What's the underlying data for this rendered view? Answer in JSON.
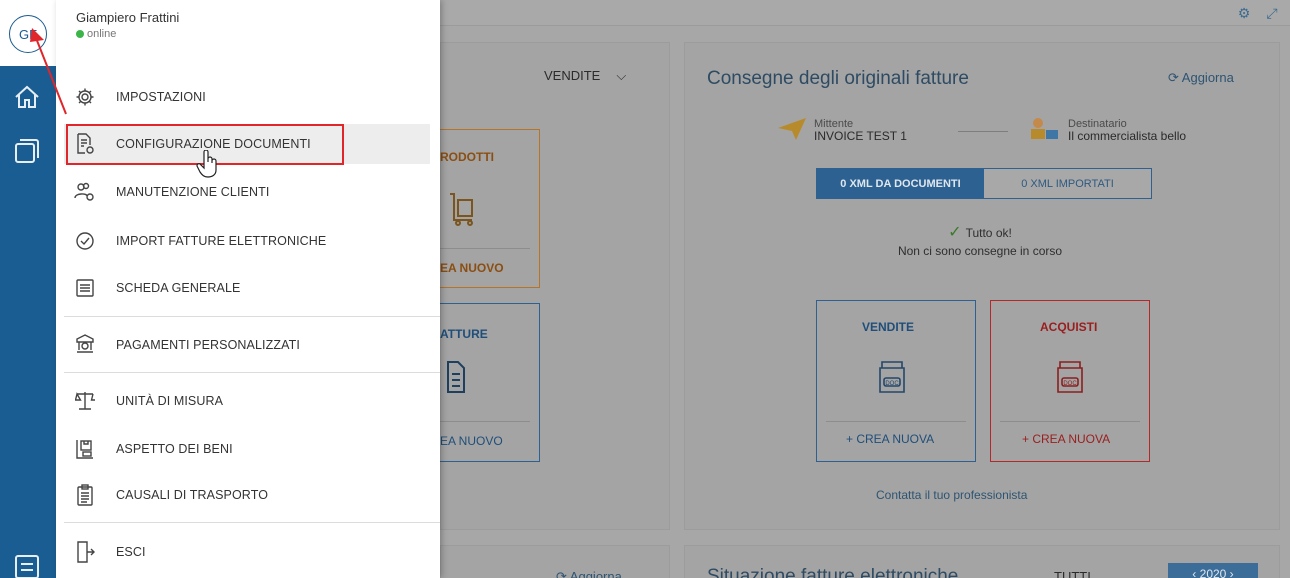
{
  "user": {
    "initials": "GF",
    "name": "Giampiero Frattini",
    "status": "online"
  },
  "menu": {
    "items": [
      {
        "label": "IMPOSTAZIONI",
        "icon": "gear-icon"
      },
      {
        "label": "CONFIGURAZIONE DOCUMENTI",
        "icon": "document-settings-icon"
      },
      {
        "label": "MANUTENZIONE CLIENTI",
        "icon": "users-settings-icon"
      },
      {
        "label": "IMPORT FATTURE ELETTRONICHE",
        "icon": "clock-check-icon"
      },
      {
        "label": "SCHEDA GENERALE",
        "icon": "list-card-icon"
      },
      {
        "label": "PAGAMENTI PERSONALIZZATI",
        "icon": "payment-settings-icon"
      },
      {
        "label": "UNITÀ DI MISURA",
        "icon": "scale-icon"
      },
      {
        "label": "ASPETTO DEI BENI",
        "icon": "box-scale-icon"
      },
      {
        "label": "CAUSALI DI TRASPORTO",
        "icon": "clipboard-list-icon"
      },
      {
        "label": "ESCI",
        "icon": "exit-door-icon"
      }
    ]
  },
  "background": {
    "vendite_dropdown": "VENDITE",
    "tile_prodotti_title": "RODOTTI",
    "tile_prodotti_foot": "EA NUOVO",
    "tile_fatture_title": "ATTURE",
    "tile_fatture_foot": "EA NUOVO",
    "consegne": {
      "title": "Consegne degli originali fatture",
      "refresh": "Aggiorna",
      "mittente_label": "Mittente",
      "mittente_value": "INVOICE TEST 1",
      "destinatario_label": "Destinatario",
      "destinatario_value": "Il commercialista bello",
      "seg_active": "0  XML DA DOCUMENTI",
      "seg_inactive": "0  XML IMPORTATI",
      "ok_title": "Tutto ok!",
      "ok_text": "Non ci sono consegne in corso",
      "vendite_title": "VENDITE",
      "vendite_foot": "+ CREA NUOVA",
      "acquisti_title": "ACQUISTI",
      "acquisti_foot": "+ CREA NUOVA",
      "doc_badge": "DOC",
      "contatta": "Contatta il tuo professionista"
    },
    "bottom_left_refresh": "Aggiorna",
    "bottom_right_title": "Situazione fatture elettroniche",
    "bottom_right_filter": "TUTTI",
    "bottom_right_year": "2020"
  },
  "colors": {
    "rail": "#1a5d92",
    "highlight": "#e0262a",
    "vendite": "#2d6191",
    "acquisti": "#b32828",
    "prodotti": "#b4742a"
  }
}
